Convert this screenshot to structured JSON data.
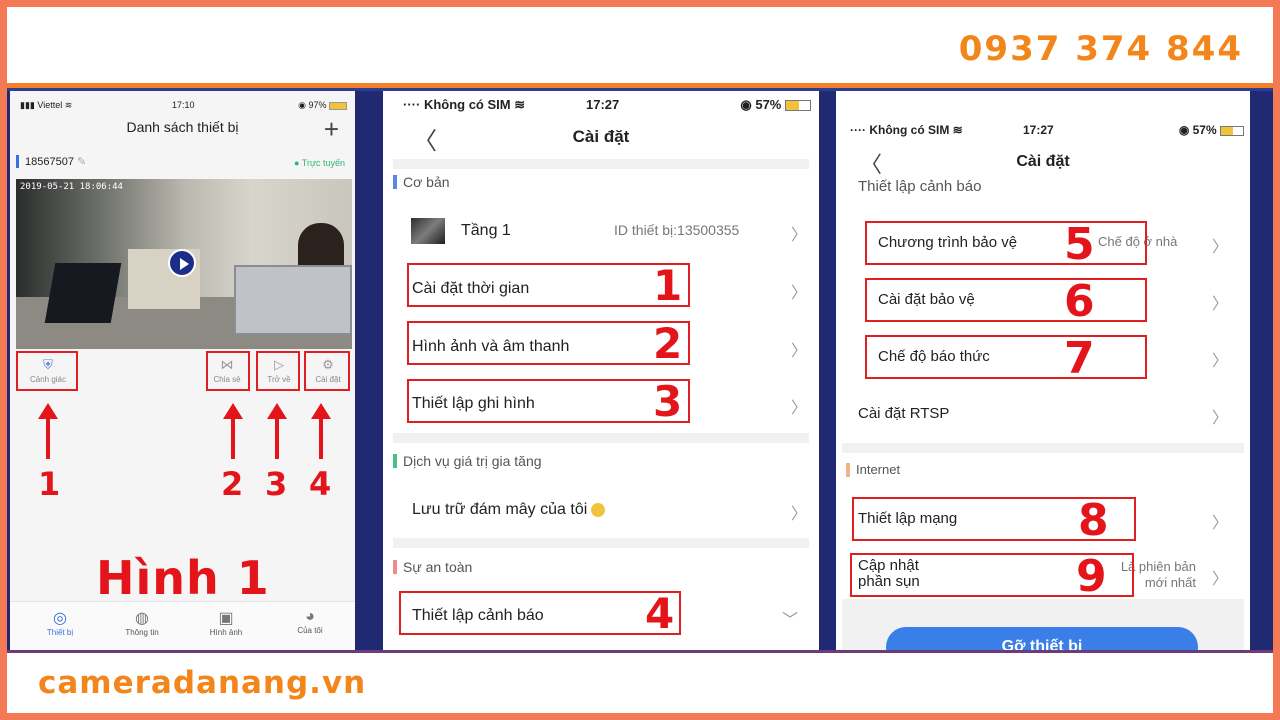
{
  "header": {
    "phone": "0937 374 844"
  },
  "footer": {
    "site": "cameradanang.vn"
  },
  "colors": {
    "accent_orange": "#f3861b",
    "annotation_red": "#e3151b",
    "primary_blue": "#3a7ee8"
  },
  "screen1": {
    "status": {
      "carrier": "Viettel",
      "time": "17:10",
      "battery": "97%"
    },
    "title": "Danh sách thiết bị",
    "add_icon": "plus-icon",
    "device_id": "18567507",
    "online_label": "Trực tuyến",
    "timestamp": "2019-05-21 18:06:44",
    "tools": {
      "guard": "Cảnh giác",
      "share": "Chia sẻ",
      "playback": "Trở về",
      "settings": "Cài đặt"
    },
    "annotations": [
      "1",
      "2",
      "3",
      "4"
    ],
    "caption": "Hình 1",
    "tabs": [
      "Thiết bị",
      "Thông tin",
      "Hình ảnh",
      "Của tôi"
    ]
  },
  "screen2": {
    "status": {
      "carrier": "Không có SIM",
      "time": "17:27",
      "battery": "57%"
    },
    "title": "Cài đặt",
    "section_basic": "Cơ bản",
    "device_name": "Tầng 1",
    "device_id_label": "ID thiết bị:13500355",
    "rows": [
      "Cài đặt thời gian",
      "Hình ảnh và âm thanh",
      "Thiết lập ghi hình"
    ],
    "section_vas": "Dịch vụ giá trị gia tăng",
    "cloud": "Lưu trữ đám mây của tôi",
    "section_safety": "Sự an toàn",
    "alarm": "Thiết lập cảnh báo",
    "annotations": [
      "1",
      "2",
      "3",
      "4"
    ]
  },
  "screen3": {
    "status": {
      "carrier": "Không có SIM",
      "time": "17:27",
      "battery": "57%"
    },
    "title": "Cài đặt",
    "cut_row": "Thiết lập cảnh báo",
    "rows": [
      "Chương trình bảo vệ",
      "Cài đặt bảo vệ",
      "Chế độ báo thức",
      "Cài đặt RTSP"
    ],
    "protect_value": "Chế độ ở nhà",
    "section_internet": "Internet",
    "network": "Thiết lập mạng",
    "firmware_line1": "Cập nhật",
    "firmware_line2": "phần sụn",
    "firmware_value1": "Là phiên bản",
    "firmware_value2": "mới nhất",
    "remove_button": "Gỡ thiết bị",
    "annotations": [
      "5",
      "6",
      "7",
      "8",
      "9"
    ]
  }
}
